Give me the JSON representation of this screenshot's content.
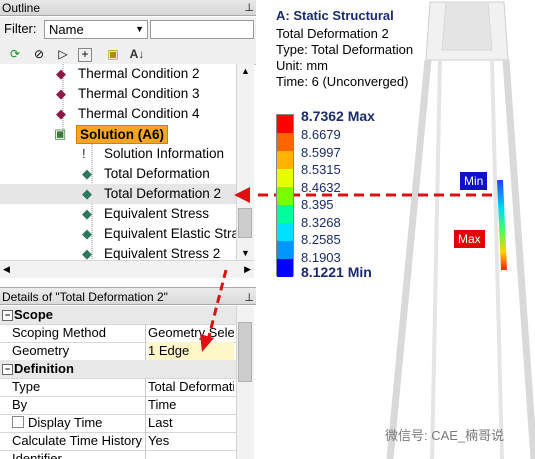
{
  "outline": {
    "title": "Outline",
    "pin": "⊥",
    "filter_label": "Filter:",
    "filter_value": "Name",
    "tree": [
      {
        "label": "Thermal Condition 2",
        "icon": "thermal-condition-icon",
        "indent": 78
      },
      {
        "label": "Thermal Condition 3",
        "icon": "thermal-condition-icon",
        "indent": 78
      },
      {
        "label": "Thermal Condition 4",
        "icon": "thermal-condition-icon",
        "indent": 78
      },
      {
        "label": "Solution (A6)",
        "icon": "solution-icon",
        "indent": 76,
        "highlight": true
      },
      {
        "label": "Solution Information",
        "icon": "solution-information-icon",
        "indent": 104
      },
      {
        "label": "Total Deformation",
        "icon": "result-icon",
        "indent": 104
      },
      {
        "label": "Total Deformation 2",
        "icon": "result-icon",
        "indent": 104,
        "selected": true
      },
      {
        "label": "Equivalent Stress",
        "icon": "result-icon",
        "indent": 104
      },
      {
        "label": "Equivalent Elastic Stra",
        "icon": "result-icon",
        "indent": 104
      },
      {
        "label": "Equivalent Stress 2",
        "icon": "result-icon",
        "indent": 104
      }
    ]
  },
  "details": {
    "title": "Details of \"Total Deformation 2\"",
    "pin": "⊥",
    "rows": [
      {
        "type": "group",
        "key": "Scope"
      },
      {
        "type": "item",
        "key": "Scoping Method",
        "value": "Geometry Selection"
      },
      {
        "type": "item",
        "key": "Geometry",
        "value": "1 Edge",
        "highlight": true
      },
      {
        "type": "group",
        "key": "Definition"
      },
      {
        "type": "item",
        "key": "Type",
        "value": "Total Deformation"
      },
      {
        "type": "item",
        "key": "By",
        "value": "Time"
      },
      {
        "type": "check",
        "key": "Display Time",
        "value": "Last"
      },
      {
        "type": "item",
        "key": "Calculate Time History",
        "value": "Yes"
      },
      {
        "type": "item",
        "key": "Identifier",
        "value": ""
      }
    ]
  },
  "result": {
    "analysis": "A: Static Structural",
    "name": "Total Deformation 2",
    "type_line": "Type: Total Deformation",
    "unit_line": "Unit: mm",
    "time_line": "Time: 6 (Unconverged)",
    "legend_max": "8.7362 Max",
    "legend_values": [
      "8.6679",
      "8.5997",
      "8.5315",
      "8.4632",
      "8.395",
      "8.3268",
      "8.2585",
      "8.1903"
    ],
    "legend_min": "8.1221 Min",
    "legend_colors": [
      "#ff0000",
      "#ff6400",
      "#ffb400",
      "#e6ff00",
      "#78ff00",
      "#00ff9a",
      "#00e0ff",
      "#0096ff",
      "#0000ff"
    ],
    "probe_min": "Min",
    "probe_max": "Max",
    "min_color": "#1010c8",
    "max_color": "#e60000"
  },
  "watermark": "微信号: CAE_楠哥说"
}
